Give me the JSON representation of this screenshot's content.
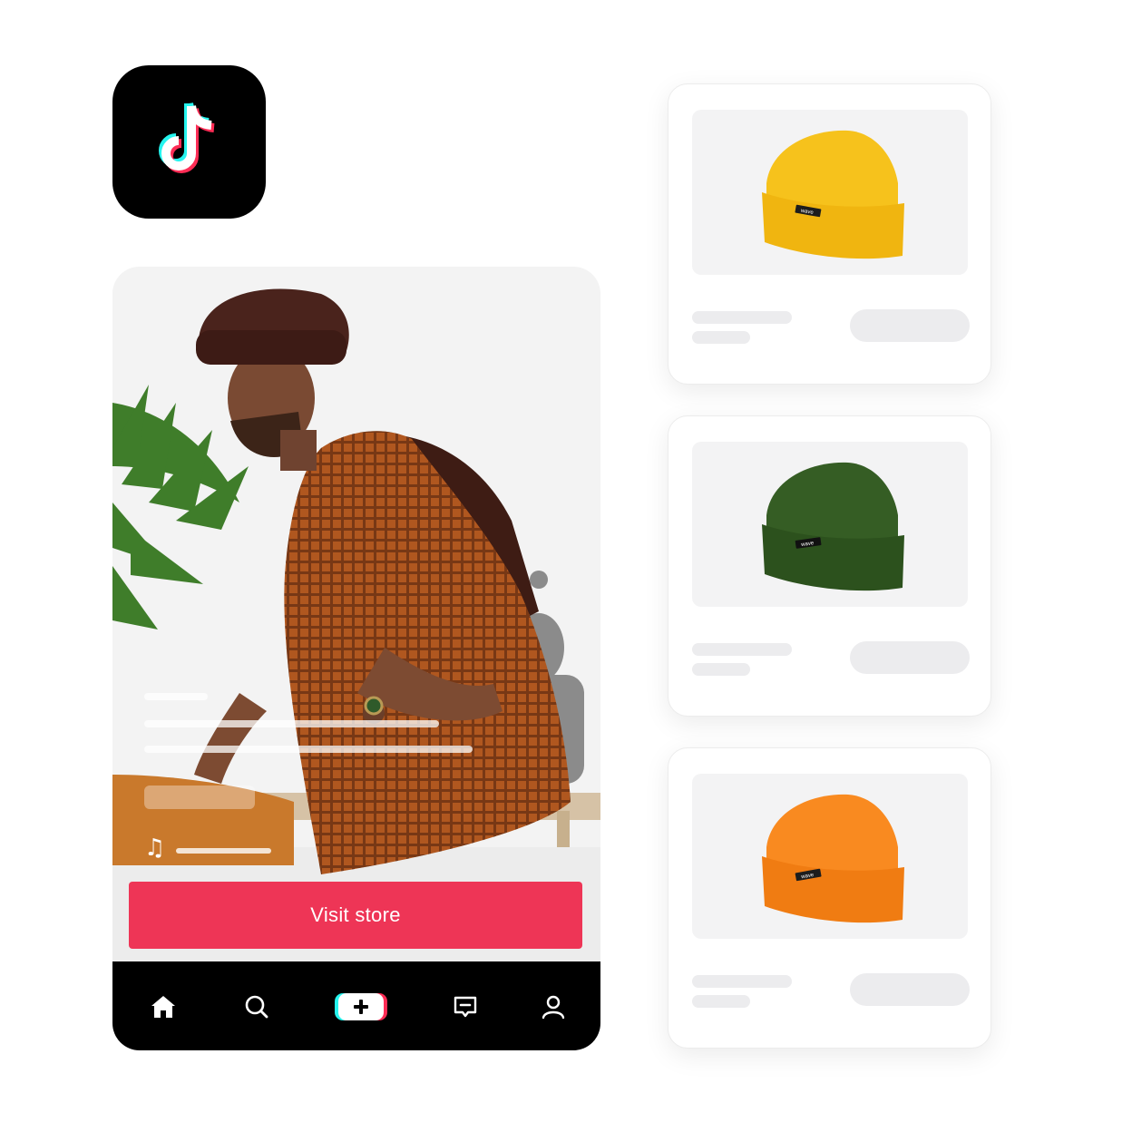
{
  "app_icon": {
    "name": "tiktok-logo-icon",
    "background": "#000000",
    "accent_cyan": "#25f4ee",
    "accent_red": "#fe2c55"
  },
  "video": {
    "cta_label": "Visit store",
    "cta_color": "#ee3556",
    "music_icon": "music-note-icon"
  },
  "tabbar": {
    "background": "#000000",
    "items": [
      {
        "icon": "home-icon"
      },
      {
        "icon": "search-icon"
      },
      {
        "icon": "create-plus-icon"
      },
      {
        "icon": "inbox-icon"
      },
      {
        "icon": "profile-icon"
      }
    ]
  },
  "products": [
    {
      "icon": "beanie-yellow-icon",
      "color": "#f6c21c",
      "tag": "wave"
    },
    {
      "icon": "beanie-green-icon",
      "color": "#355d24",
      "tag": "wave"
    },
    {
      "icon": "beanie-orange-icon",
      "color": "#f98a20",
      "tag": "wave"
    }
  ]
}
